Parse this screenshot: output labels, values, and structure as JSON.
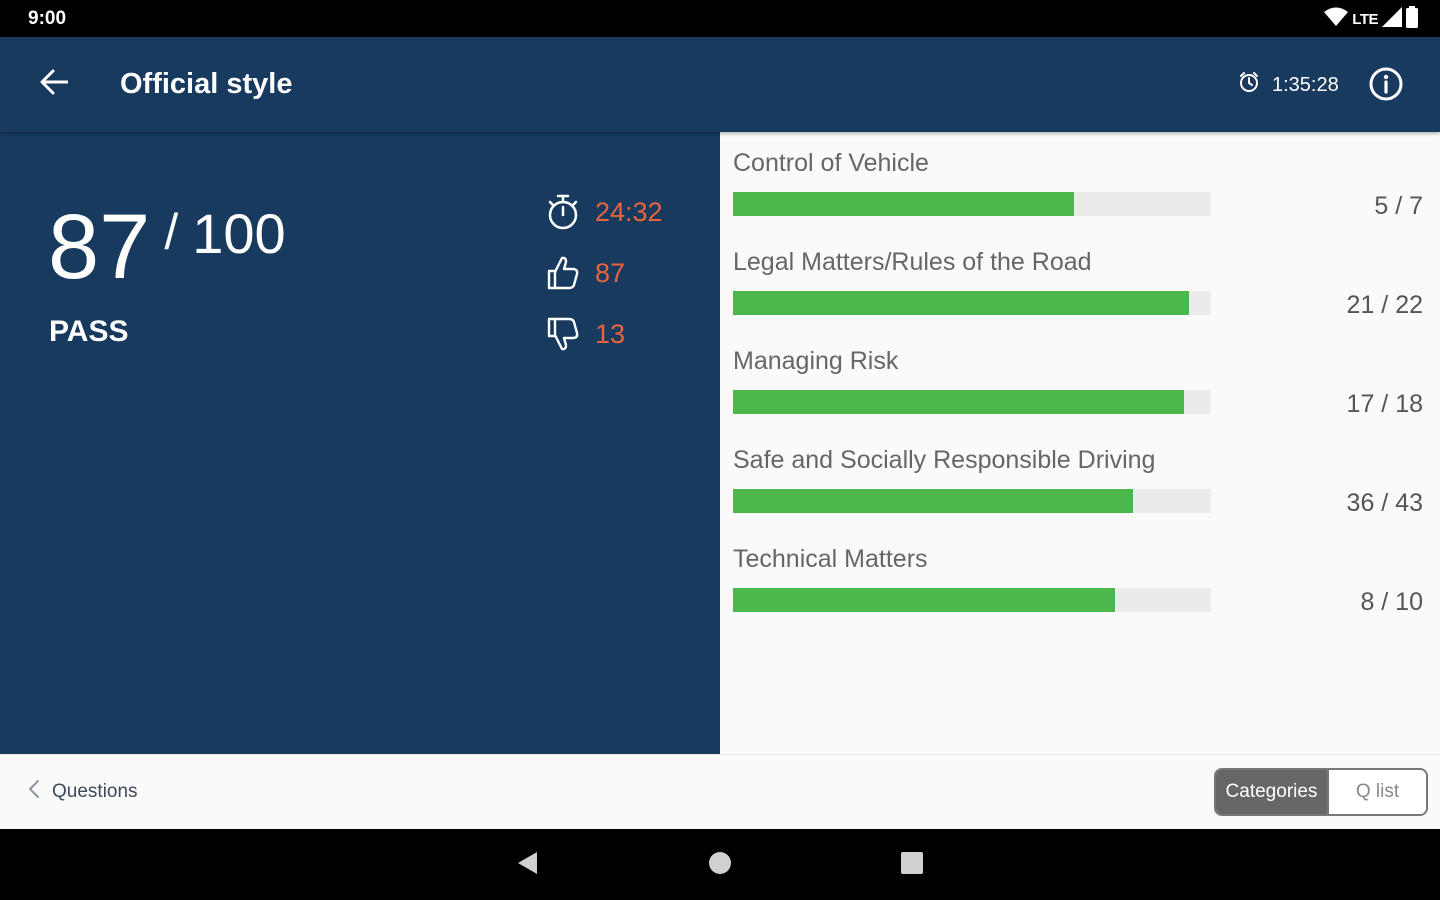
{
  "status_bar": {
    "time": "9:00",
    "network": "LTE",
    "icons": [
      "wifi-icon",
      "signal-icon",
      "battery-icon"
    ]
  },
  "app_bar": {
    "title": "Official style",
    "timer": "1:35:28",
    "icons": [
      "back-arrow-icon",
      "clock-icon",
      "info-icon"
    ]
  },
  "summary": {
    "score": "87",
    "slash": "/",
    "total": "100",
    "result": "PASS",
    "time_taken": "24:32",
    "correct": "87",
    "incorrect": "13",
    "icons": [
      "stopwatch-icon",
      "thumbs-up-icon",
      "thumbs-down-icon"
    ]
  },
  "categories": [
    {
      "name": "Control of Vehicle",
      "score": "5 / 7",
      "fraction": 0.714
    },
    {
      "name": "Legal Matters/Rules of the Road",
      "score": "21 / 22",
      "fraction": 0.955
    },
    {
      "name": "Managing Risk",
      "score": "17 / 18",
      "fraction": 0.944
    },
    {
      "name": "Safe and Socially Responsible Driving",
      "score": "36 / 43",
      "fraction": 0.837
    },
    {
      "name": "Technical Matters",
      "score": "8 / 10",
      "fraction": 0.8
    }
  ],
  "bottom_bar": {
    "questions_label": "Questions",
    "tabs": [
      {
        "label": "Categories",
        "active": true
      },
      {
        "label": "Q list",
        "active": false
      }
    ]
  },
  "colors": {
    "primary": "#173a5e",
    "accent": "#e8643c",
    "progress": "#4cb84c",
    "track": "#ebebeb"
  },
  "nav_bar": {
    "icons": [
      "back-triangle-icon",
      "home-circle-icon",
      "recents-square-icon"
    ]
  }
}
